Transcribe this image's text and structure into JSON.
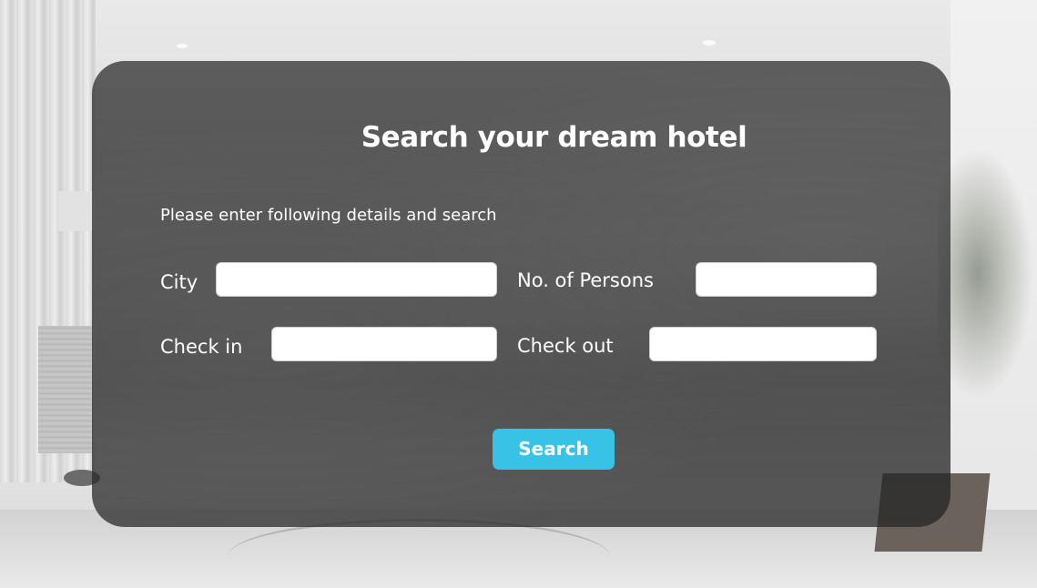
{
  "form": {
    "title": "Search your dream hotel",
    "subtitle": "Please enter following details and search",
    "fields": {
      "city": {
        "label": "City",
        "value": "",
        "placeholder": ""
      },
      "persons": {
        "label": "No. of Persons",
        "value": "",
        "placeholder": ""
      },
      "checkin": {
        "label": "Check in",
        "value": "",
        "placeholder": ""
      },
      "checkout": {
        "label": "Check out",
        "value": "",
        "placeholder": ""
      }
    },
    "search_label": "Search"
  },
  "colors": {
    "panel": "#282828",
    "button": "#38c3e6",
    "text": "#ffffff",
    "input_bg": "#ffffff"
  }
}
